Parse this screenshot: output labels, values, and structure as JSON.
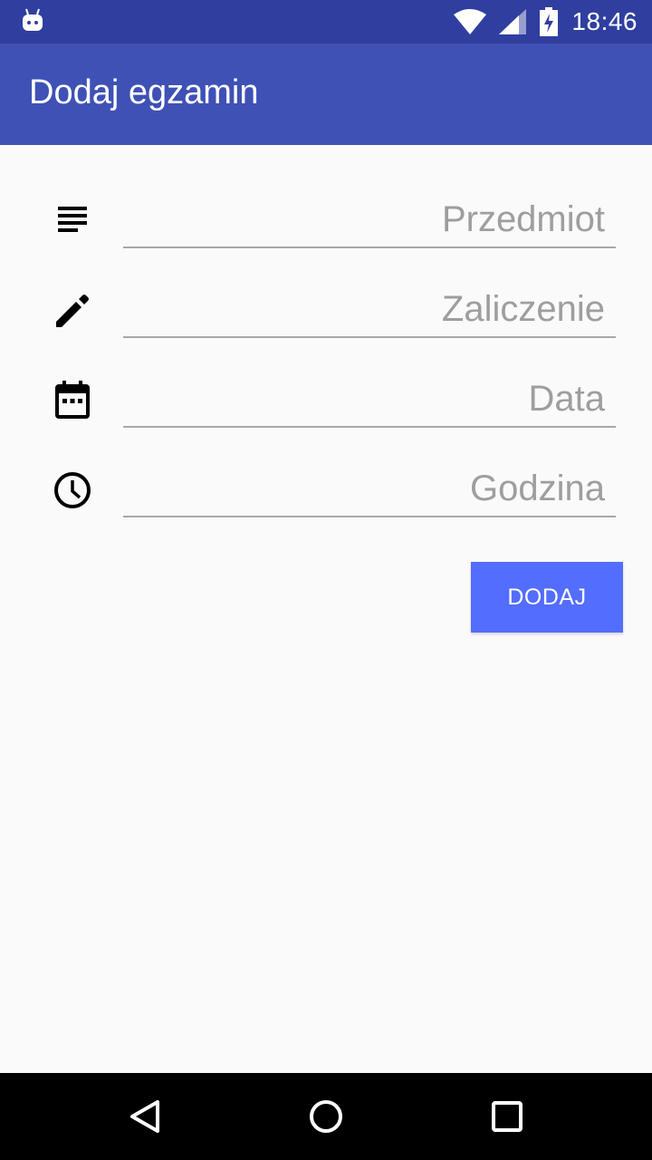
{
  "status_bar": {
    "time": "18:46",
    "icons": [
      "android-debug-icon",
      "wifi-icon",
      "signal-icon",
      "battery-charging-icon"
    ]
  },
  "app_bar": {
    "title": "Dodaj egzamin"
  },
  "form": {
    "subject": {
      "placeholder": "Przedmiot",
      "icon": "subject-lines-icon"
    },
    "credit": {
      "placeholder": "Zaliczenie",
      "icon": "pencil-icon"
    },
    "date": {
      "placeholder": "Data",
      "icon": "calendar-icon"
    },
    "time": {
      "placeholder": "Godzina",
      "icon": "clock-icon"
    }
  },
  "actions": {
    "add_label": "DODAJ"
  },
  "colors": {
    "status_bar": "#303f9f",
    "app_bar": "#3f51b5",
    "accent_button": "#536dfe",
    "background": "#fafafa",
    "placeholder_text": "#9e9e9e",
    "underline": "#a8a8a8"
  },
  "nav_bar": {
    "buttons": [
      "back-icon",
      "home-icon",
      "recents-icon"
    ]
  }
}
